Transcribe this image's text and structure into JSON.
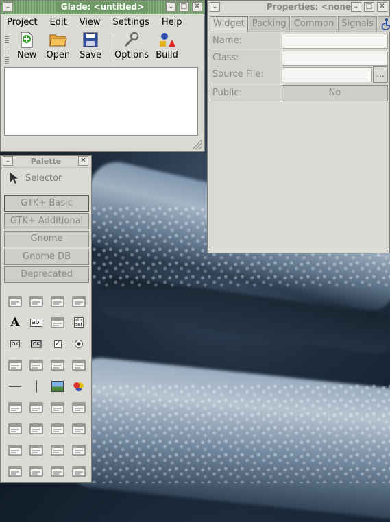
{
  "glade_window": {
    "title": "Glade: <untitled>",
    "menu": [
      "Project",
      "Edit",
      "View",
      "Settings",
      "Help"
    ],
    "toolbar": [
      {
        "label": "New",
        "icon": "new-icon"
      },
      {
        "label": "Open",
        "icon": "open-folder-icon"
      },
      {
        "label": "Save",
        "icon": "save-icon"
      },
      {
        "label": "Options",
        "icon": "wrench-icon"
      },
      {
        "label": "Build",
        "icon": "build-icon"
      }
    ],
    "buttons": {
      "minimize": "⌄",
      "maximize": "□",
      "close": "✕"
    }
  },
  "palette": {
    "title": "Palette",
    "selector_label": "Selector",
    "groups": [
      "GTK+ Basic",
      "GTK+ Additional",
      "Gnome",
      "Gnome DB",
      "Deprecated"
    ],
    "widget_icons": [
      "window-icon",
      "menubar-icon",
      "toolbar-icon",
      "handlebox-icon",
      "label-icon",
      "entry-icon",
      "text-view-icon",
      "text-icon",
      "button-icon",
      "toggle-button-icon",
      "check-button-icon",
      "radio-button-icon",
      "option-menu-icon",
      "combo-icon",
      "spin-button-icon",
      "list-icon",
      "hseparator-icon",
      "vseparator-icon",
      "image-icon",
      "color-icon",
      "dialog-icon",
      "file-selection-icon",
      "font-icon",
      "color-selection-icon",
      "hbox-icon",
      "vbox-icon",
      "table-icon",
      "fixed-icon",
      "hruler-icon",
      "vruler-icon",
      "hscale-icon",
      "vscale-icon",
      "frame-icon",
      "notebook-icon",
      "scrolled-icon",
      "viewport-icon"
    ]
  },
  "properties": {
    "title": "Properties: <none>",
    "tabs": [
      "Widget",
      "Packing",
      "Common",
      "Signals",
      "accessibility-icon"
    ],
    "rows": [
      {
        "label": "Name:",
        "value": ""
      },
      {
        "label": "Class:",
        "value": ""
      },
      {
        "label": "Source File:",
        "value": "",
        "button": "..."
      },
      {
        "label": "Public:",
        "value": "No"
      }
    ]
  },
  "colors": {
    "active_title": "#6f9a65",
    "window_bg": "#dcdad5",
    "disabled_text": "#8a8884"
  }
}
